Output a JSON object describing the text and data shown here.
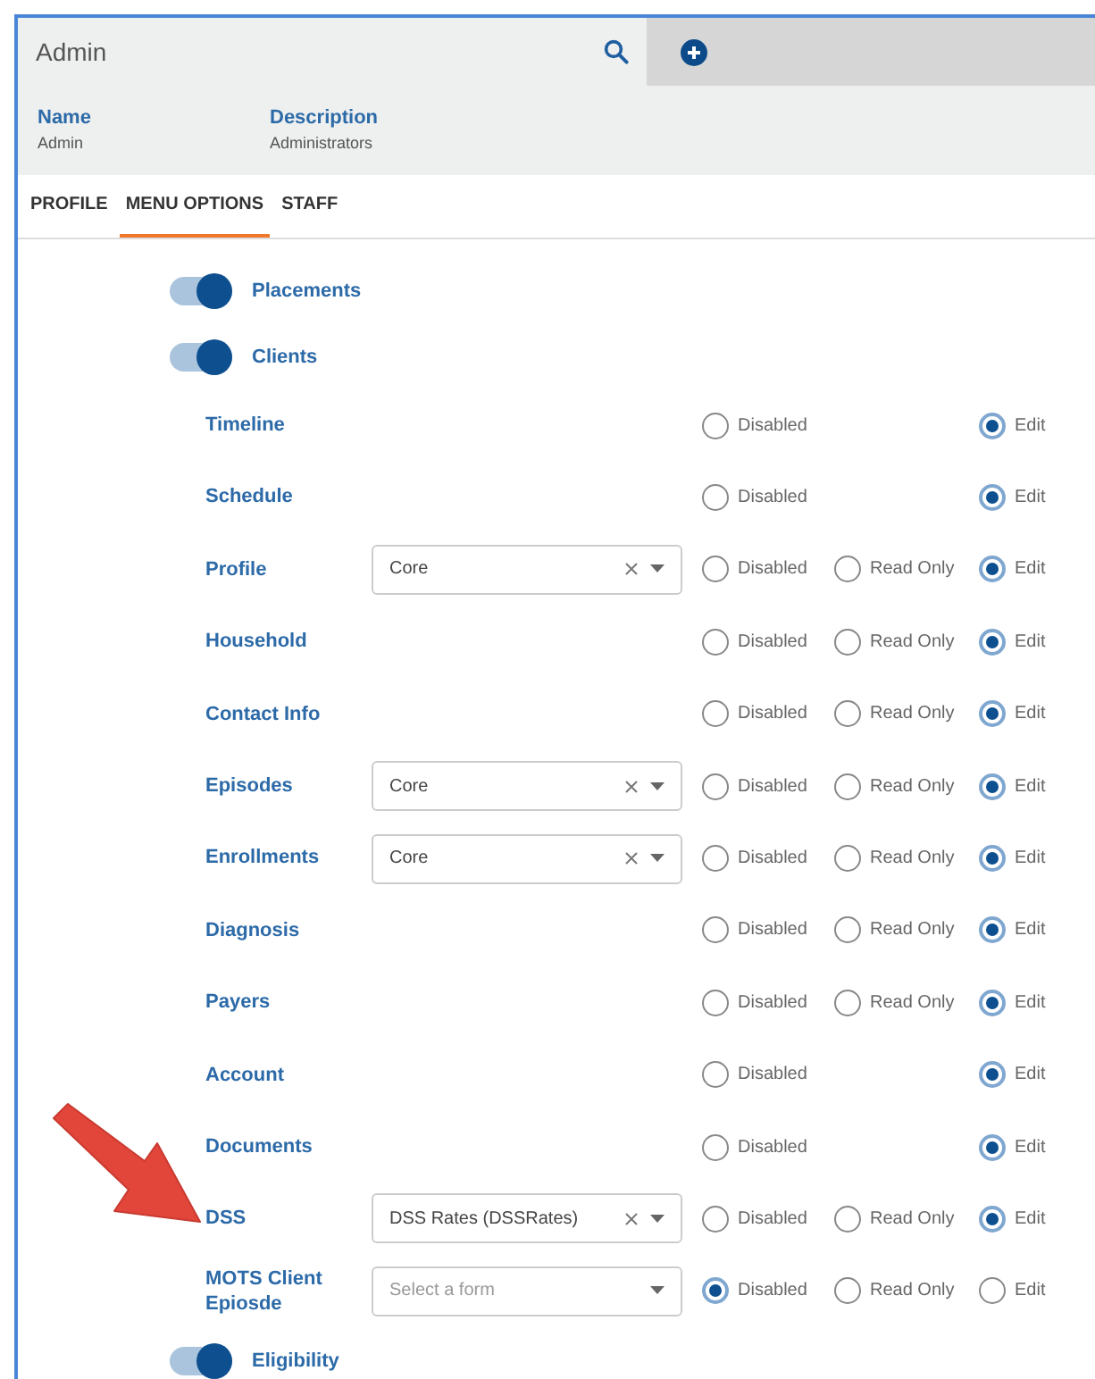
{
  "header": {
    "title": "Admin"
  },
  "fields": [
    {
      "label": "Name",
      "value": "Admin"
    },
    {
      "label": "Description",
      "value": "Administrators"
    }
  ],
  "tabs": [
    {
      "label": "PROFILE",
      "selected": false
    },
    {
      "label": "MENU OPTIONS",
      "selected": true
    },
    {
      "label": "STAFF",
      "selected": false
    }
  ],
  "menu": [
    {
      "label": "Placements",
      "on": true
    },
    {
      "label": "Clients",
      "on": true,
      "children": [
        {
          "label": "Timeline",
          "options": [
            {
              "kind": "disabled",
              "label": "Disabled",
              "selected": false
            },
            {
              "kind": "edit",
              "label": "Edit",
              "selected": true
            }
          ]
        },
        {
          "label": "Schedule",
          "options": [
            {
              "kind": "disabled",
              "label": "Disabled",
              "selected": false
            },
            {
              "kind": "edit",
              "label": "Edit",
              "selected": true
            }
          ]
        },
        {
          "label": "Profile",
          "select": {
            "value": "Core",
            "clearable": true
          },
          "options": [
            {
              "kind": "disabled",
              "label": "Disabled",
              "selected": false
            },
            {
              "kind": "read_only",
              "label": "Read Only",
              "selected": false
            },
            {
              "kind": "edit",
              "label": "Edit",
              "selected": true
            }
          ]
        },
        {
          "label": "Household",
          "options": [
            {
              "kind": "disabled",
              "label": "Disabled",
              "selected": false
            },
            {
              "kind": "read_only",
              "label": "Read Only",
              "selected": false
            },
            {
              "kind": "edit",
              "label": "Edit",
              "selected": true
            }
          ]
        },
        {
          "label": "Contact Info",
          "options": [
            {
              "kind": "disabled",
              "label": "Disabled",
              "selected": false
            },
            {
              "kind": "read_only",
              "label": "Read Only",
              "selected": false
            },
            {
              "kind": "edit",
              "label": "Edit",
              "selected": true
            }
          ]
        },
        {
          "label": "Episodes",
          "select": {
            "value": "Core",
            "clearable": true
          },
          "options": [
            {
              "kind": "disabled",
              "label": "Disabled",
              "selected": false
            },
            {
              "kind": "read_only",
              "label": "Read Only",
              "selected": false
            },
            {
              "kind": "edit",
              "label": "Edit",
              "selected": true
            }
          ]
        },
        {
          "label": "Enrollments",
          "select": {
            "value": "Core",
            "clearable": true
          },
          "options": [
            {
              "kind": "disabled",
              "label": "Disabled",
              "selected": false
            },
            {
              "kind": "read_only",
              "label": "Read Only",
              "selected": false
            },
            {
              "kind": "edit",
              "label": "Edit",
              "selected": true
            }
          ]
        },
        {
          "label": "Diagnosis",
          "options": [
            {
              "kind": "disabled",
              "label": "Disabled",
              "selected": false
            },
            {
              "kind": "read_only",
              "label": "Read Only",
              "selected": false
            },
            {
              "kind": "edit",
              "label": "Edit",
              "selected": true
            }
          ]
        },
        {
          "label": "Payers",
          "options": [
            {
              "kind": "disabled",
              "label": "Disabled",
              "selected": false
            },
            {
              "kind": "read_only",
              "label": "Read Only",
              "selected": false
            },
            {
              "kind": "edit",
              "label": "Edit",
              "selected": true
            }
          ]
        },
        {
          "label": "Account",
          "options": [
            {
              "kind": "disabled",
              "label": "Disabled",
              "selected": false
            },
            {
              "kind": "edit",
              "label": "Edit",
              "selected": true
            }
          ]
        },
        {
          "label": "Documents",
          "options": [
            {
              "kind": "disabled",
              "label": "Disabled",
              "selected": false
            },
            {
              "kind": "edit",
              "label": "Edit",
              "selected": true
            }
          ]
        },
        {
          "label": "DSS",
          "select": {
            "value": "DSS Rates (DSSRates)",
            "clearable": true
          },
          "options": [
            {
              "kind": "disabled",
              "label": "Disabled",
              "selected": false
            },
            {
              "kind": "read_only",
              "label": "Read Only",
              "selected": false
            },
            {
              "kind": "edit",
              "label": "Edit",
              "selected": true
            }
          ]
        },
        {
          "label": "MOTS Client Epiosde",
          "select": {
            "placeholder": "Select a form",
            "clearable": false
          },
          "options": [
            {
              "kind": "disabled",
              "label": "Disabled",
              "selected": true
            },
            {
              "kind": "read_only",
              "label": "Read Only",
              "selected": false
            },
            {
              "kind": "edit",
              "label": "Edit",
              "selected": false
            }
          ]
        }
      ]
    },
    {
      "label": "Eligibility",
      "on": true
    }
  ]
}
